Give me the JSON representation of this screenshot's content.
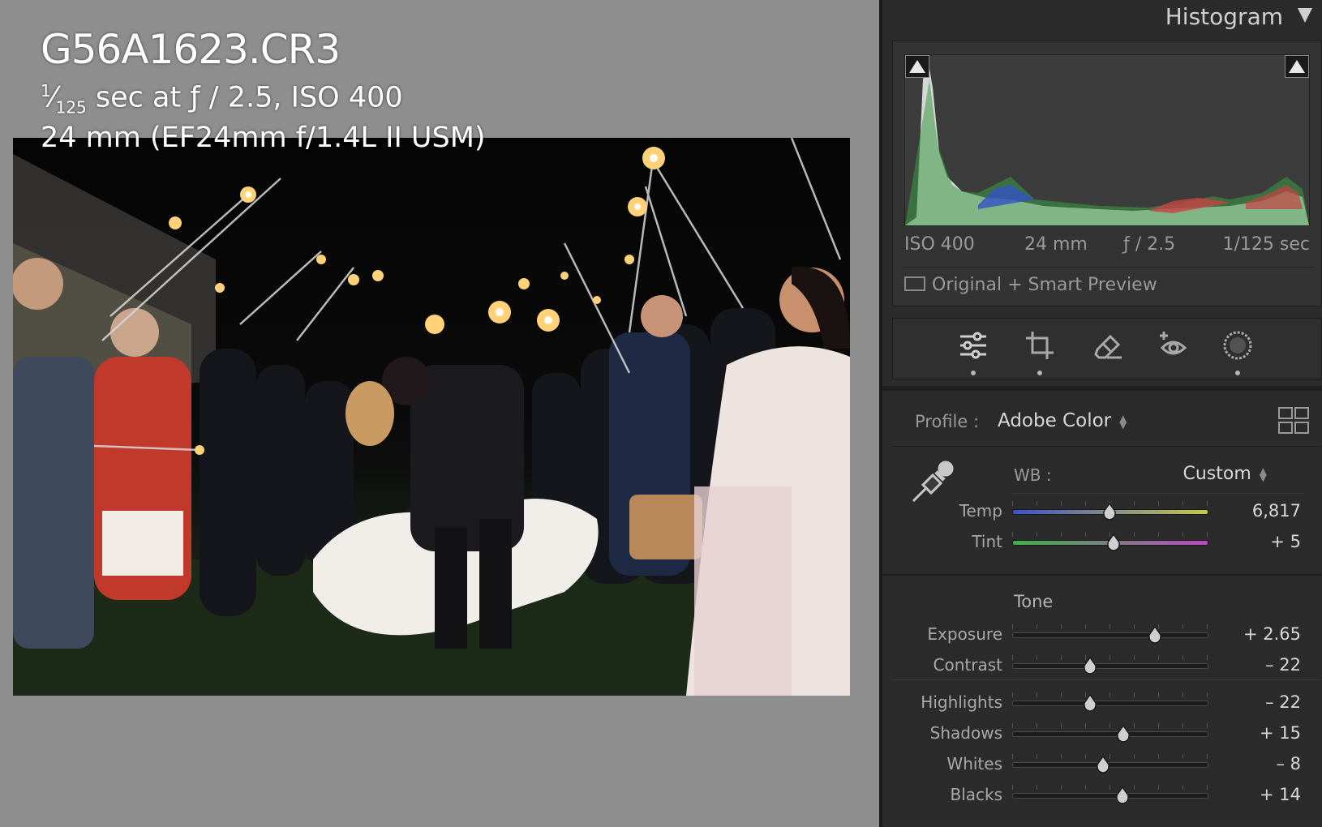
{
  "photo_info": {
    "filename": "G56A1623.CR3",
    "shutter_numerator": "1",
    "shutter_denominator": "125",
    "exposure_rest": " sec at ƒ / 2.5, ISO 400",
    "lens": "24 mm (EF24mm f/1.4L II USM)"
  },
  "histogram": {
    "title": "Histogram",
    "iso": "ISO 400",
    "focal_length": "24 mm",
    "aperture": "ƒ / 2.5",
    "shutter": "1/125 sec",
    "preview_status": "Original + Smart Preview"
  },
  "tools": [
    "edit-sliders-icon",
    "crop-icon",
    "eraser-icon",
    "red-eye-icon",
    "masking-icon"
  ],
  "profile": {
    "label": "Profile :",
    "value": "Adobe Color"
  },
  "white_balance": {
    "label": "WB :",
    "value": "Custom",
    "sliders": [
      {
        "label": "Temp",
        "value": "6,817",
        "position": 0.5
      },
      {
        "label": "Tint",
        "value": "+ 5",
        "position": 0.52
      }
    ]
  },
  "tone": {
    "title": "Tone",
    "sliders_group1": [
      {
        "label": "Exposure",
        "value": "+ 2.65",
        "position": 0.735
      },
      {
        "label": "Contrast",
        "value": "– 22",
        "position": 0.4
      }
    ],
    "sliders_group2": [
      {
        "label": "Highlights",
        "value": "– 22",
        "position": 0.4
      },
      {
        "label": "Shadows",
        "value": "+ 15",
        "position": 0.57
      },
      {
        "label": "Whites",
        "value": "– 8",
        "position": 0.465
      },
      {
        "label": "Blacks",
        "value": "+ 14",
        "position": 0.565
      }
    ]
  },
  "colors": {
    "panel_bg": "#2b2b2b",
    "viewer_bg": "#8e8e8e",
    "temp_gradient": [
      "#3f52c8",
      "#c8c84a"
    ],
    "tint_gradient": [
      "#3fb04a",
      "#b84ac0"
    ]
  }
}
